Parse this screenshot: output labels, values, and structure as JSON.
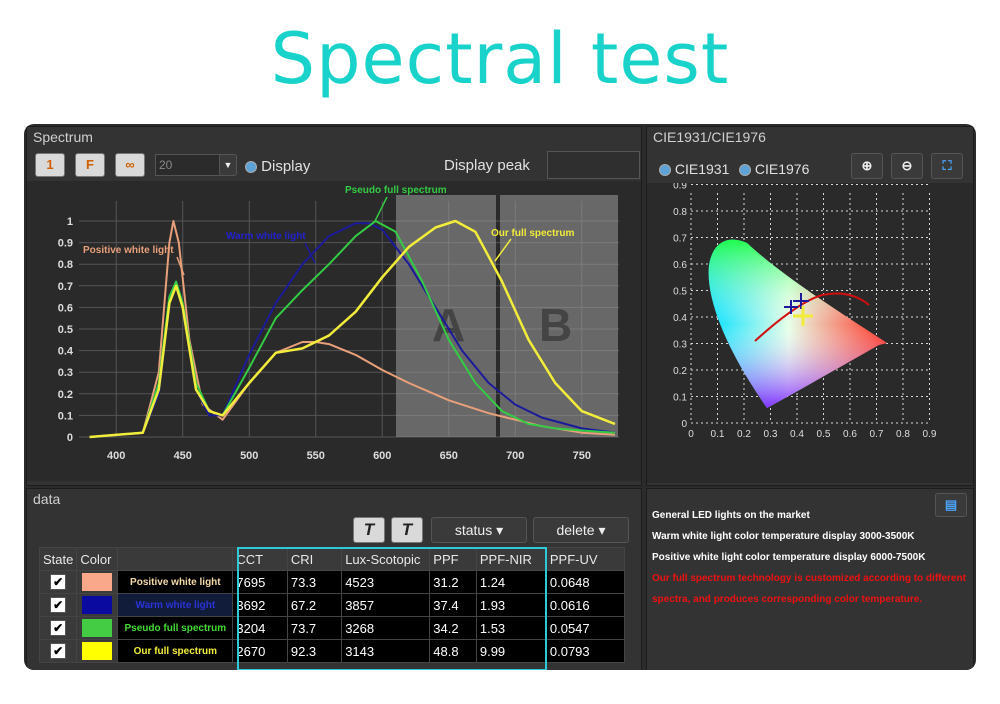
{
  "page_title": "Spectral test",
  "spectrum_panel": {
    "title": "Spectrum",
    "buttons": [
      "1",
      "F",
      "∞"
    ],
    "count_value": "20",
    "display_label": "Display",
    "display_peak_label": "Display peak",
    "region_labels": [
      "A",
      "B"
    ],
    "curve_labels": {
      "positive": "Positive white light",
      "warm": "Warm white light",
      "pseudo": "Pseudo full spectrum",
      "ours": "Our full spectrum"
    }
  },
  "chart_data": {
    "type": "line",
    "x_ticks": [
      "400",
      "450",
      "500",
      "550",
      "600",
      "650",
      "700",
      "750"
    ],
    "y_ticks": [
      "0",
      "0.1",
      "0.2",
      "0.3",
      "0.4",
      "0.5",
      "0.6",
      "0.7",
      "0.8",
      "0.9",
      "1"
    ],
    "xlim": [
      372,
      778
    ],
    "ylim": [
      0,
      1
    ],
    "series": [
      {
        "name": "Positive white light",
        "color": "#e8a07a",
        "x": [
          380,
          420,
          432,
          440,
          443,
          447,
          455,
          465,
          480,
          500,
          520,
          540,
          550,
          560,
          580,
          600,
          620,
          650,
          680,
          700,
          720,
          750,
          775
        ],
        "y": [
          0,
          0.02,
          0.3,
          0.9,
          1.0,
          0.9,
          0.45,
          0.15,
          0.08,
          0.25,
          0.39,
          0.44,
          0.44,
          0.43,
          0.38,
          0.31,
          0.25,
          0.17,
          0.11,
          0.08,
          0.05,
          0.02,
          0.01
        ]
      },
      {
        "name": "Warm white light",
        "color": "#1a1a9a",
        "x": [
          380,
          420,
          432,
          440,
          445,
          450,
          460,
          470,
          480,
          500,
          520,
          540,
          560,
          580,
          590,
          600,
          620,
          640,
          660,
          680,
          700,
          720,
          750,
          775
        ],
        "y": [
          0,
          0.02,
          0.2,
          0.62,
          0.72,
          0.6,
          0.22,
          0.1,
          0.1,
          0.38,
          0.62,
          0.8,
          0.93,
          0.99,
          0.99,
          0.96,
          0.8,
          0.6,
          0.4,
          0.25,
          0.15,
          0.09,
          0.04,
          0.02
        ]
      },
      {
        "name": "Pseudo full spectrum",
        "color": "#33cc44",
        "x": [
          380,
          420,
          432,
          440,
          445,
          450,
          460,
          470,
          480,
          500,
          520,
          540,
          560,
          580,
          595,
          610,
          630,
          650,
          670,
          690,
          710,
          730,
          750,
          775
        ],
        "y": [
          0,
          0.02,
          0.25,
          0.65,
          0.72,
          0.62,
          0.25,
          0.12,
          0.1,
          0.32,
          0.55,
          0.68,
          0.8,
          0.93,
          1.0,
          0.95,
          0.72,
          0.45,
          0.25,
          0.12,
          0.06,
          0.04,
          0.03,
          0.02
        ]
      },
      {
        "name": "Our full spectrum",
        "color": "#f2ec3a",
        "x": [
          380,
          420,
          432,
          440,
          445,
          450,
          460,
          470,
          480,
          500,
          520,
          540,
          560,
          580,
          600,
          620,
          640,
          655,
          670,
          690,
          710,
          730,
          750,
          775
        ],
        "y": [
          0,
          0.02,
          0.22,
          0.62,
          0.7,
          0.6,
          0.22,
          0.12,
          0.1,
          0.25,
          0.39,
          0.41,
          0.47,
          0.58,
          0.74,
          0.88,
          0.97,
          1.0,
          0.95,
          0.72,
          0.45,
          0.25,
          0.12,
          0.06
        ]
      }
    ]
  },
  "cie_panel": {
    "title": "CIE1931/CIE1976",
    "options": [
      "CIE1931",
      "CIE1976"
    ],
    "x_ticks": [
      "0",
      "0.1",
      "0.2",
      "0.3",
      "0.4",
      "0.5",
      "0.6",
      "0.7",
      "0.8",
      "0.9"
    ],
    "y_ticks": [
      "0",
      "0.1",
      "0.2",
      "0.3",
      "0.4",
      "0.5",
      "0.6",
      "0.7",
      "0.8",
      "0.9"
    ],
    "icons": [
      "zoom-in-icon",
      "zoom-out-icon",
      "fit-screen-icon"
    ]
  },
  "data_panel": {
    "title": "data",
    "status_label": "status",
    "delete_label": "delete",
    "columns": [
      "State",
      "Color",
      "",
      "CCT",
      "CRI",
      "Lux-Scotopic",
      "PPF",
      "PPF-NIR",
      "PPF-UV"
    ],
    "rows": [
      {
        "color": "#f9a98a",
        "name": "Positive white light",
        "name_color": "#f3d9a8",
        "name_bg": "#000000",
        "cct": "7695",
        "cri": "73.3",
        "lux": "4523",
        "ppf": "31.2",
        "nir": "1.24",
        "uv": "0.0648"
      },
      {
        "color": "#0a0aa0",
        "name": "Warm white light",
        "name_color": "#2a33d6",
        "name_bg": "#111c3a",
        "cct": "3692",
        "cri": "67.2",
        "lux": "3857",
        "ppf": "37.4",
        "nir": "1.93",
        "uv": "0.0616"
      },
      {
        "color": "#44cc44",
        "name": "Pseudo full spectrum",
        "name_color": "#44dd33",
        "name_bg": "#000000",
        "cct": "3204",
        "cri": "73.7",
        "lux": "3268",
        "ppf": "34.2",
        "nir": "1.53",
        "uv": "0.0547"
      },
      {
        "color": "#ffff00",
        "name": "Our full spectrum",
        "name_color": "#f3ee3a",
        "name_bg": "#000000",
        "cct": "2670",
        "cri": "92.3",
        "lux": "3143",
        "ppf": "48.8",
        "nir": "9.99",
        "uv": "0.0793"
      }
    ]
  },
  "notes": [
    {
      "text": "General LED lights on the market",
      "color": "#ffffff"
    },
    {
      "text": "Warm white light color temperature display 3000-3500K",
      "color": "#ffffff"
    },
    {
      "text": "Positive white light color temperature display 6000-7500K",
      "color": "#ffffff"
    },
    {
      "text": "Our full spectrum technology is customized according to different",
      "color": "#ee1111"
    },
    {
      "text": "spectra, and produces corresponding color temperature.",
      "color": "#ee1111"
    }
  ]
}
